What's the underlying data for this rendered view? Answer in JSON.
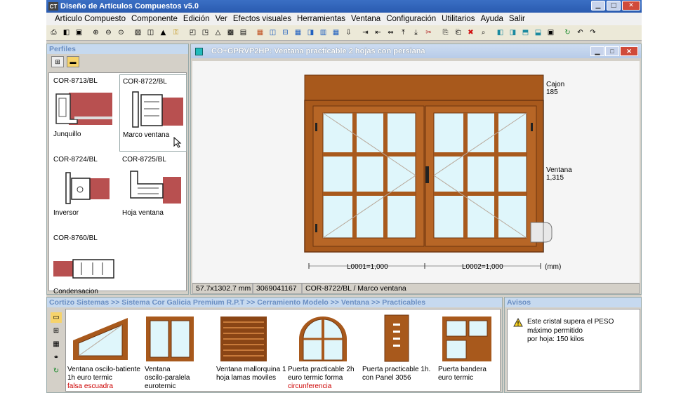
{
  "app": {
    "title": "Diseño de Artículos Compuestos v5.0",
    "icon_label": "CT"
  },
  "menu": [
    "Artículo Compuesto",
    "Componente",
    "Edición",
    "Ver",
    "Efectos visuales",
    "Herramientas",
    "Ventana",
    "Configuración",
    "Utilitarios",
    "Ayuda",
    "Salir"
  ],
  "toolbar_icons": [
    "print-preview",
    "new-doc",
    "save",
    "zoom-in",
    "zoom-out",
    "zoom-fit",
    "image",
    "export",
    "graduation",
    "key",
    "window-frame",
    "window-frame-2",
    "triangle",
    "image-2",
    "screen",
    "brick",
    "split-v",
    "split-h",
    "grid",
    "split-v2",
    "grid-2",
    "grid-3",
    "down-arrow",
    "right-bar",
    "left-bar",
    "arrows",
    "up-bar",
    "down-bar",
    "scissors",
    "copy",
    "paste",
    "delete",
    "search-doc",
    "box-left",
    "box-right",
    "box-up",
    "box-down",
    "frame",
    "refresh",
    "back",
    "forward"
  ],
  "perfiles": {
    "title": "Perfiles",
    "items": [
      {
        "code": "COR-8713/BL",
        "name": "Junquillo"
      },
      {
        "code": "COR-8722/BL",
        "name": "Marco ventana"
      },
      {
        "code": "COR-8724/BL",
        "name": "Inversor"
      },
      {
        "code": "COR-8725/BL",
        "name": "Hoja ventana"
      },
      {
        "code": "COR-8760/BL",
        "name": "Condensacion"
      }
    ]
  },
  "document": {
    "title": "CO+GPRVP2HP: Ventana practicable 2 hojas con persiana",
    "dims": {
      "cajon_label": "Cajon",
      "cajon_value": "185",
      "ventana_label": "Ventana",
      "ventana_value": "1,315",
      "l1": "L0001=1,000",
      "l2": "L0002=1,000",
      "unit": "(mm)"
    },
    "status": {
      "size": "57.7x1302.7 mm",
      "id": "3069041167",
      "profile": "COR-8722/BL / Marco ventana"
    }
  },
  "catalog": {
    "breadcrumb": "Cortizo Sistemas >> Sistema Cor Galicia Premium R.P.T >> Cerramiento Modelo >> Ventana >> Practicables",
    "items": [
      {
        "line1": "Ventana oscilo-batiente",
        "line2": "1h euro termic",
        "line3": "falsa escuadra"
      },
      {
        "line1": "Ventana",
        "line2": "oscilo-paralela",
        "line3": "euroternic"
      },
      {
        "line1": "Ventana mallorquina 1",
        "line2": "hoja lamas moviles",
        "line3": ""
      },
      {
        "line1": "Puerta practicable 2h",
        "line2": "euro termic forma",
        "line3": "circunferencia"
      },
      {
        "line1": "Puerta practicable 1h.",
        "line2": "con  Panel 3056",
        "line3": ""
      },
      {
        "line1": "Puerta bandera",
        "line2": "euro termic",
        "line3": ""
      }
    ]
  },
  "avisos": {
    "title": "Avisos",
    "line1": "Este cristal supera el PESO",
    "line2": "máximo permitido",
    "line3": "por hoja: 150 kilos"
  },
  "colors": {
    "wood": "#a8591c",
    "wood_dark": "#6d3510",
    "glass": "#dff6fb",
    "title_blue": "#2a5bb0",
    "panel_title_text": "#6b8fc3"
  }
}
